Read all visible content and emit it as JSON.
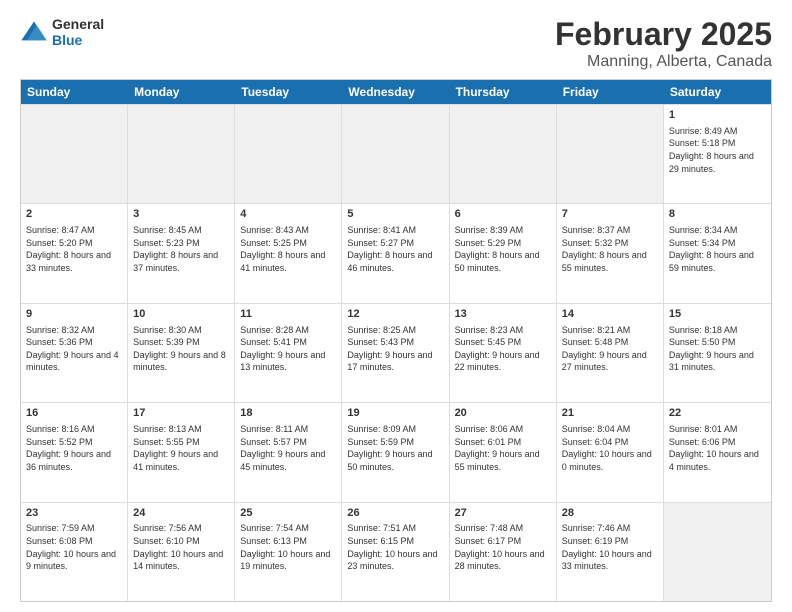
{
  "header": {
    "logo": {
      "general": "General",
      "blue": "Blue"
    },
    "title": "February 2025",
    "subtitle": "Manning, Alberta, Canada"
  },
  "calendar": {
    "days": [
      "Sunday",
      "Monday",
      "Tuesday",
      "Wednesday",
      "Thursday",
      "Friday",
      "Saturday"
    ],
    "weeks": [
      [
        {
          "day": "",
          "empty": true
        },
        {
          "day": "",
          "empty": true
        },
        {
          "day": "",
          "empty": true
        },
        {
          "day": "",
          "empty": true
        },
        {
          "day": "",
          "empty": true
        },
        {
          "day": "",
          "empty": true
        },
        {
          "day": "1",
          "content": "Sunrise: 8:49 AM\nSunset: 5:18 PM\nDaylight: 8 hours and 29 minutes."
        }
      ],
      [
        {
          "day": "2",
          "content": "Sunrise: 8:47 AM\nSunset: 5:20 PM\nDaylight: 8 hours and 33 minutes."
        },
        {
          "day": "3",
          "content": "Sunrise: 8:45 AM\nSunset: 5:23 PM\nDaylight: 8 hours and 37 minutes."
        },
        {
          "day": "4",
          "content": "Sunrise: 8:43 AM\nSunset: 5:25 PM\nDaylight: 8 hours and 41 minutes."
        },
        {
          "day": "5",
          "content": "Sunrise: 8:41 AM\nSunset: 5:27 PM\nDaylight: 8 hours and 46 minutes."
        },
        {
          "day": "6",
          "content": "Sunrise: 8:39 AM\nSunset: 5:29 PM\nDaylight: 8 hours and 50 minutes."
        },
        {
          "day": "7",
          "content": "Sunrise: 8:37 AM\nSunset: 5:32 PM\nDaylight: 8 hours and 55 minutes."
        },
        {
          "day": "8",
          "content": "Sunrise: 8:34 AM\nSunset: 5:34 PM\nDaylight: 8 hours and 59 minutes."
        }
      ],
      [
        {
          "day": "9",
          "content": "Sunrise: 8:32 AM\nSunset: 5:36 PM\nDaylight: 9 hours and 4 minutes."
        },
        {
          "day": "10",
          "content": "Sunrise: 8:30 AM\nSunset: 5:39 PM\nDaylight: 9 hours and 8 minutes."
        },
        {
          "day": "11",
          "content": "Sunrise: 8:28 AM\nSunset: 5:41 PM\nDaylight: 9 hours and 13 minutes."
        },
        {
          "day": "12",
          "content": "Sunrise: 8:25 AM\nSunset: 5:43 PM\nDaylight: 9 hours and 17 minutes."
        },
        {
          "day": "13",
          "content": "Sunrise: 8:23 AM\nSunset: 5:45 PM\nDaylight: 9 hours and 22 minutes."
        },
        {
          "day": "14",
          "content": "Sunrise: 8:21 AM\nSunset: 5:48 PM\nDaylight: 9 hours and 27 minutes."
        },
        {
          "day": "15",
          "content": "Sunrise: 8:18 AM\nSunset: 5:50 PM\nDaylight: 9 hours and 31 minutes."
        }
      ],
      [
        {
          "day": "16",
          "content": "Sunrise: 8:16 AM\nSunset: 5:52 PM\nDaylight: 9 hours and 36 minutes."
        },
        {
          "day": "17",
          "content": "Sunrise: 8:13 AM\nSunset: 5:55 PM\nDaylight: 9 hours and 41 minutes."
        },
        {
          "day": "18",
          "content": "Sunrise: 8:11 AM\nSunset: 5:57 PM\nDaylight: 9 hours and 45 minutes."
        },
        {
          "day": "19",
          "content": "Sunrise: 8:09 AM\nSunset: 5:59 PM\nDaylight: 9 hours and 50 minutes."
        },
        {
          "day": "20",
          "content": "Sunrise: 8:06 AM\nSunset: 6:01 PM\nDaylight: 9 hours and 55 minutes."
        },
        {
          "day": "21",
          "content": "Sunrise: 8:04 AM\nSunset: 6:04 PM\nDaylight: 10 hours and 0 minutes."
        },
        {
          "day": "22",
          "content": "Sunrise: 8:01 AM\nSunset: 6:06 PM\nDaylight: 10 hours and 4 minutes."
        }
      ],
      [
        {
          "day": "23",
          "content": "Sunrise: 7:59 AM\nSunset: 6:08 PM\nDaylight: 10 hours and 9 minutes."
        },
        {
          "day": "24",
          "content": "Sunrise: 7:56 AM\nSunset: 6:10 PM\nDaylight: 10 hours and 14 minutes."
        },
        {
          "day": "25",
          "content": "Sunrise: 7:54 AM\nSunset: 6:13 PM\nDaylight: 10 hours and 19 minutes."
        },
        {
          "day": "26",
          "content": "Sunrise: 7:51 AM\nSunset: 6:15 PM\nDaylight: 10 hours and 23 minutes."
        },
        {
          "day": "27",
          "content": "Sunrise: 7:48 AM\nSunset: 6:17 PM\nDaylight: 10 hours and 28 minutes."
        },
        {
          "day": "28",
          "content": "Sunrise: 7:46 AM\nSunset: 6:19 PM\nDaylight: 10 hours and 33 minutes."
        },
        {
          "day": "",
          "empty": true
        }
      ]
    ]
  }
}
